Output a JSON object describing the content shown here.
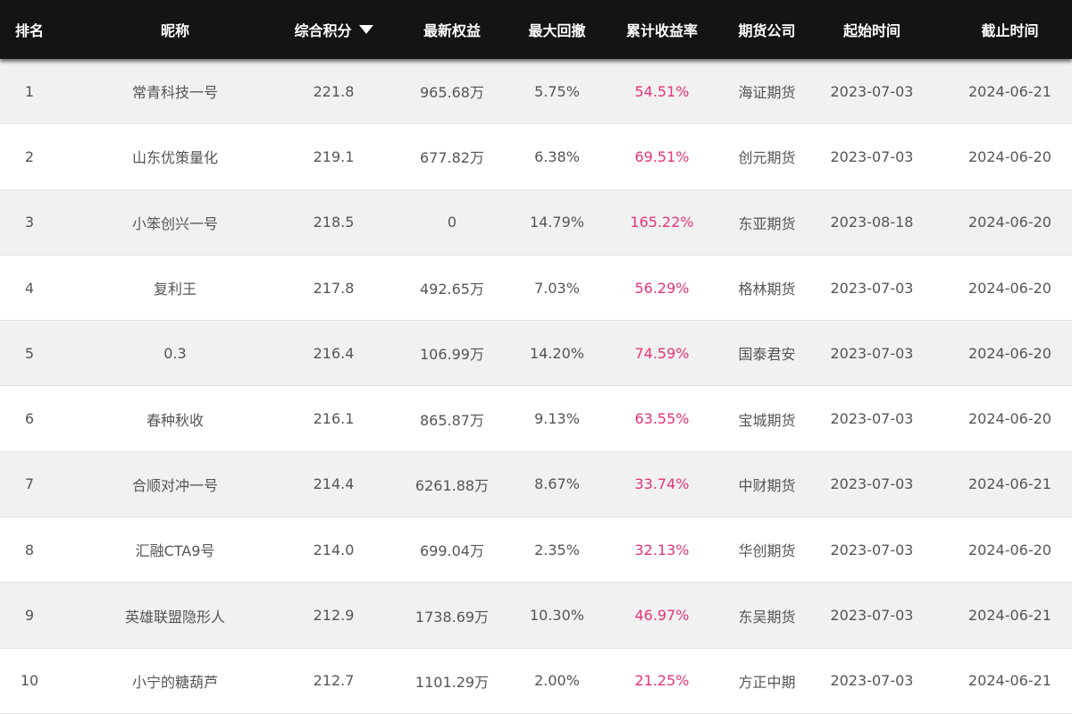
{
  "header": {
    "rank": "排名",
    "nickname": "昵称",
    "score": "综合积分",
    "equity": "最新权益",
    "max_drawdown": "最大回撤",
    "cumulative_return": "累计收益率",
    "futures_company": "期货公司",
    "start_time": "起始时间",
    "end_time": "截止时间"
  },
  "sort_icon": "caret-down-icon",
  "colors": {
    "header_bg": "#141414",
    "return_text": "#e6337a",
    "row_alt": "#f1f1f1"
  },
  "rows": [
    {
      "rank": "1",
      "nickname": "常青科技一号",
      "score": "221.8",
      "equity": "965.68万",
      "max_drawdown": "5.75%",
      "cumulative_return": "54.51%",
      "futures_company": "海证期货",
      "start_time": "2023-07-03",
      "end_time": "2024-06-21"
    },
    {
      "rank": "2",
      "nickname": "山东优策量化",
      "score": "219.1",
      "equity": "677.82万",
      "max_drawdown": "6.38%",
      "cumulative_return": "69.51%",
      "futures_company": "创元期货",
      "start_time": "2023-07-03",
      "end_time": "2024-06-20"
    },
    {
      "rank": "3",
      "nickname": "小笨创兴一号",
      "score": "218.5",
      "equity": "0",
      "max_drawdown": "14.79%",
      "cumulative_return": "165.22%",
      "futures_company": "东亚期货",
      "start_time": "2023-08-18",
      "end_time": "2024-06-20"
    },
    {
      "rank": "4",
      "nickname": "复利王",
      "score": "217.8",
      "equity": "492.65万",
      "max_drawdown": "7.03%",
      "cumulative_return": "56.29%",
      "futures_company": "格林期货",
      "start_time": "2023-07-03",
      "end_time": "2024-06-20"
    },
    {
      "rank": "5",
      "nickname": "0.3",
      "score": "216.4",
      "equity": "106.99万",
      "max_drawdown": "14.20%",
      "cumulative_return": "74.59%",
      "futures_company": "国泰君安",
      "start_time": "2023-07-03",
      "end_time": "2024-06-20"
    },
    {
      "rank": "6",
      "nickname": "春种秋收",
      "score": "216.1",
      "equity": "865.87万",
      "max_drawdown": "9.13%",
      "cumulative_return": "63.55%",
      "futures_company": "宝城期货",
      "start_time": "2023-07-03",
      "end_time": "2024-06-20"
    },
    {
      "rank": "7",
      "nickname": "合顺对冲一号",
      "score": "214.4",
      "equity": "6261.88万",
      "max_drawdown": "8.67%",
      "cumulative_return": "33.74%",
      "futures_company": "中财期货",
      "start_time": "2023-07-03",
      "end_time": "2024-06-21"
    },
    {
      "rank": "8",
      "nickname": "汇融CTA9号",
      "score": "214.0",
      "equity": "699.04万",
      "max_drawdown": "2.35%",
      "cumulative_return": "32.13%",
      "futures_company": "华创期货",
      "start_time": "2023-07-03",
      "end_time": "2024-06-20"
    },
    {
      "rank": "9",
      "nickname": "英雄联盟隐形人",
      "score": "212.9",
      "equity": "1738.69万",
      "max_drawdown": "10.30%",
      "cumulative_return": "46.97%",
      "futures_company": "东吴期货",
      "start_time": "2023-07-03",
      "end_time": "2024-06-21"
    },
    {
      "rank": "10",
      "nickname": "小宁的糖葫芦",
      "score": "212.7",
      "equity": "1101.29万",
      "max_drawdown": "2.00%",
      "cumulative_return": "21.25%",
      "futures_company": "方正中期",
      "start_time": "2023-07-03",
      "end_time": "2024-06-21"
    }
  ]
}
